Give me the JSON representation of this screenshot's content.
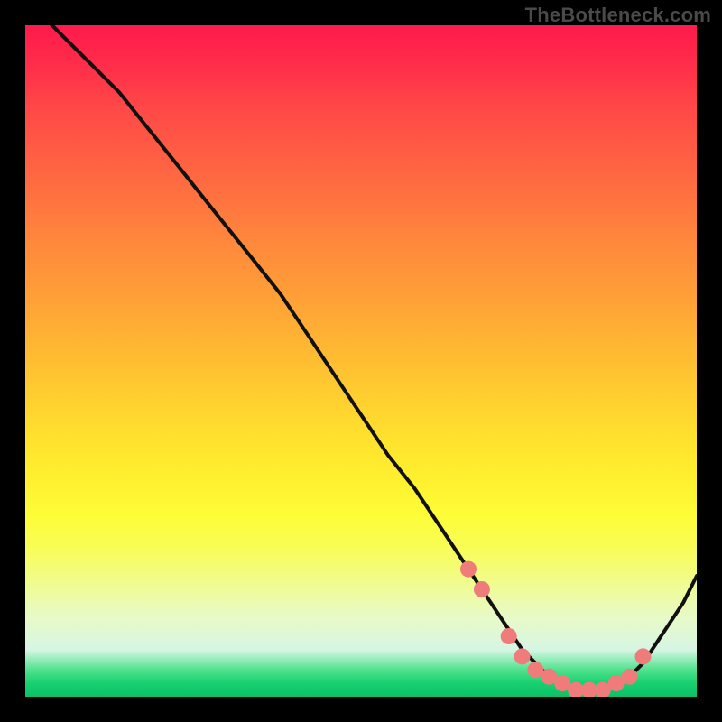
{
  "watermark": "TheBottleneck.com",
  "colors": {
    "background": "#000000",
    "curve": "#111111",
    "dots": "#f07b7b",
    "gradient_top": "#ff1a4b",
    "gradient_bottom": "#0cc069"
  },
  "chart_data": {
    "type": "line",
    "title": "",
    "xlabel": "",
    "ylabel": "",
    "xlim": [
      0,
      100
    ],
    "ylim": [
      0,
      100
    ],
    "grid": false,
    "legend": false,
    "series": [
      {
        "name": "bottleneck-curve",
        "x": [
          0,
          3,
          6,
          10,
          14,
          18,
          22,
          26,
          30,
          34,
          38,
          42,
          46,
          50,
          54,
          58,
          62,
          66,
          68,
          70,
          72,
          74,
          76,
          78,
          80,
          82,
          84,
          86,
          88,
          90,
          92,
          94,
          96,
          98,
          100
        ],
        "values": [
          104,
          101,
          98,
          94,
          90,
          85,
          80,
          75,
          70,
          65,
          60,
          54,
          48,
          42,
          36,
          31,
          25,
          19,
          16,
          13,
          10,
          7,
          5,
          3,
          2,
          1,
          1,
          1,
          2,
          3,
          5,
          8,
          11,
          14,
          18
        ]
      }
    ],
    "dots": {
      "name": "sweet-spot-markers",
      "x": [
        66,
        68,
        72,
        74,
        76,
        78,
        80,
        82,
        84,
        86,
        88,
        90,
        92
      ],
      "values": [
        19,
        16,
        9,
        6,
        4,
        3,
        2,
        1,
        1,
        1,
        2,
        3,
        6
      ]
    }
  }
}
